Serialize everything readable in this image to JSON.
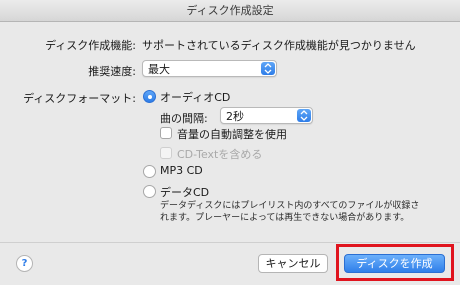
{
  "window": {
    "title": "ディスク作成設定"
  },
  "burner": {
    "label": "ディスク作成機能:",
    "value": "サポートされているディスク作成機能が見つかりません"
  },
  "speed": {
    "label": "推奨速度:",
    "value": "最大"
  },
  "format": {
    "label": "ディスクフォーマット:",
    "options": [
      {
        "label": "オーディオCD",
        "selected": true
      },
      {
        "label": "MP3 CD",
        "selected": false
      },
      {
        "label": "データCD",
        "selected": false
      }
    ],
    "gap": {
      "label": "曲の間隔:",
      "value": "2秒"
    },
    "sound_check": {
      "label": "音量の自動調整を使用",
      "checked": false
    },
    "cd_text": {
      "label": "CD-Textを含める",
      "checked": false,
      "disabled": true
    },
    "data_cd_description": "データディスクにはプレイリスト内のすべてのファイルが収録されます。プレーヤーによっては再生できない場合があります。"
  },
  "footer": {
    "help": "?",
    "cancel": "キャンセル",
    "create": "ディスクを作成"
  },
  "colors": {
    "accent": "#2e7de8",
    "highlight": "#e0141e"
  }
}
